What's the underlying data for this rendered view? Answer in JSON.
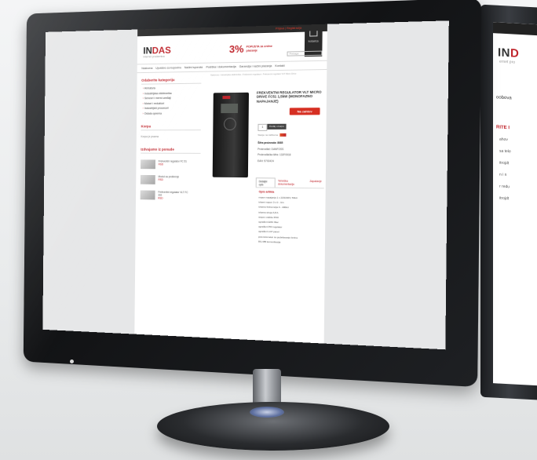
{
  "back_screen": {
    "logo_main": "IN",
    "logo_accent": "D",
    "logo_rest": "",
    "subtitle": "ernet pro",
    "nav_fragment": "oobova",
    "section_fragment": "RITE I",
    "list_fragments": [
      "ahov",
      "sa tele",
      "itrojdt",
      "n i n",
      "r redu",
      "itrojdt"
    ]
  },
  "site": {
    "top_link": "Prijava | Registracija",
    "cart_label": "košarica",
    "logo": {
      "part1": "IN",
      "part2": "DAS"
    },
    "logo_subtitle": "internet prodavnica",
    "promo": {
      "percent": "3%",
      "text": "POPUSTA za online plaćanje"
    },
    "search_placeholder": "Pretraga",
    "nav_items": [
      "Naslovna",
      "Uputstvo za kupovinu",
      "Načini isporuke",
      "Podrška i dokumentacija",
      "Garancija i načini plaćanja",
      "Kontakt"
    ],
    "breadcrumb": "Naslovna › Industrijska elektronika › Frekventni regulatori › Frekventni regulator VLT Micro Drive",
    "sidebar": {
      "categories_title": "Odaberite kategoriju",
      "categories": [
        "Armatura",
        "Industrijska elektronika",
        "Senzori i merni uređaji",
        "Motori i reduktori",
        "Industrijski procesori",
        "Ostala oprema"
      ],
      "cart_title": "Korpa",
      "cart_empty": "Korpa je prazna",
      "offers_title": "Izdvajamo iz ponude",
      "offers": [
        {
          "name": "Frekventni regulator FC 51",
          "price": "RSD"
        },
        {
          "name": "Modul za proširenje",
          "price": "RSD"
        },
        {
          "name": "Frekventni regulator VLT FC 302",
          "price": "RSD"
        }
      ]
    },
    "product": {
      "title": "FREKVENTNI REGULATOR VLT MICRO DRIVE FC51 1,5kW (MONOFAZNO NAPAJANJE)",
      "order_label": "Na zahtev",
      "qty": "1",
      "add_to_cart": "Dodaj u korpu",
      "stock_label": "Stanje na zalihama:",
      "specs": [
        "Šifra proizvoda: 8085",
        "Proizvođač: DANFOSS",
        "Proizvođačka šifra: 132F0018",
        "EAN: 5702424"
      ],
      "tabs": [
        "Detaljni opis",
        "Tehnička dokumentacija",
        "Zapažanje"
      ],
      "desc_title": "Opis artikla",
      "desc_lines": [
        "napon napajanja 1 x 220/240V, 50Hz",
        "izlazni napon 3 x 0 - Uin",
        "izlazna frekvencija 0 - 400Hz",
        "izlazna struja 6,8 A",
        "stepen zaštite IP20",
        "ugrađeni EMC filter",
        "ugrađeni PID regulator",
        "ugrađeni LCP panel",
        "potenciometar za podešavanje brzine",
        "RS-485 komunikacija"
      ]
    }
  }
}
